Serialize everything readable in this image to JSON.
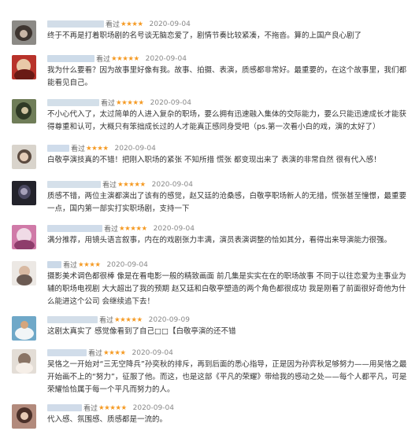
{
  "seen_label": "看过",
  "star_icon": "★",
  "colors": {
    "star": "#f59a23",
    "text": "#333333",
    "meta": "#888888"
  },
  "reviews": [
    {
      "stars": 4,
      "date": "2020-09-04",
      "text": "终于不再是打着职场剧的名号谈无脑恋爱了，剧情节奏比较紧凑，不拖沓。算的上国产良心剧了"
    },
    {
      "stars": 5,
      "date": "2020-09-04",
      "text": "我为什么要看？因为故事里好像有我。故事、拍摄、表演，质感都非常好。最重要的，在这个故事里，我们都能看见自己。"
    },
    {
      "stars": 5,
      "date": "2020-09-04",
      "text": "不小心代入了，太过简单的人进入复杂的职场，要么拥有迅速融入集体的交际能力，要么只能迅速成长才能获得尊重和认可，大概只有笨拙成长过的人才能真正感同身受吧（ps.第一次看小白的戏，演的太好了）"
    },
    {
      "stars": 4,
      "date": "2020-09-04",
      "text": "白敬亭演技真的不错！把刚入职场的紧张 不知所措 慌张 都变现出来了 表演的非常自然 很有代入感！"
    },
    {
      "stars": 5,
      "date": "2020-09-04",
      "text": "质感不错，两位主演都演出了该有的感觉，赵又廷的沧桑感，白敬亭职场新人的无措，慌张甚至憧憬，最重要一点，国内第一部实打实职场剧，支持一下"
    },
    {
      "stars": 5,
      "date": "2020-09-04",
      "text": "满分推荐，用镜头语言叙事，内在的戏剧张力丰满，演员表演调整的恰如其分，看得出来导演能力很强。"
    },
    {
      "stars": 4,
      "date": "2020-09-04",
      "text": "摄影美术调色都很棒 像是在看电影一般的精致画面 前几集是实实在在的职场故事 不同于以往恋爱为主事业为辅的职场电视剧 大大超出了我的预期 赵又廷和白敬亭塑造的两个角色都很成功 我是刚看了前面很好奇他为什么能进这个公司 会继续追下去！"
    },
    {
      "stars": 5,
      "date": "2020-09-09",
      "text": "这剧太真实了 感觉像看到了自己□□【白敬亭演的还不错"
    },
    {
      "stars": 4,
      "date": "2020-09-04",
      "text": "吴恪之一开始对“三无空降兵”孙奕秋的排斥，再到后面的悉心指导，正是因为孙弈秋足够努力——用吴恪之最开始画不上的“努力”，征服了他。而这，也是这部《平凡的荣耀》带给我的感动之处——每个人都平凡，可是荣耀恰恰属于每一个平凡而努力的人。"
    },
    {
      "stars": 5,
      "date": "2020-09-04",
      "text": "代入感、氛围感、质感都是一流的。"
    }
  ]
}
